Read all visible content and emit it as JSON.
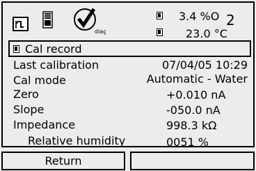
{
  "status": {
    "measurement_1": {
      "value": "3.4 %O",
      "subscript": "2"
    },
    "measurement_2": {
      "value": "23.0 °C"
    },
    "diag_label": "diag"
  },
  "title_bar": {
    "title": "Cal record"
  },
  "rows": [
    {
      "label": "Last calibration",
      "value": "07/04/05 10:29"
    },
    {
      "label": "Cal mode",
      "value": "Automatic - Water"
    },
    {
      "label": "Zero",
      "value": "+0.010 nA"
    },
    {
      "label": "Slope",
      "value": "-050.0 nA"
    },
    {
      "label": "Impedance",
      "value": "998.3 kΩ"
    },
    {
      "label": "Relative humidity",
      "value": "0051 %"
    }
  ],
  "footer": {
    "left_softkey": "Return",
    "right_softkey": ""
  },
  "icons": [
    "graph-icon",
    "battery-icon",
    "diag-check-icon",
    "measurement-indicator-icon"
  ]
}
